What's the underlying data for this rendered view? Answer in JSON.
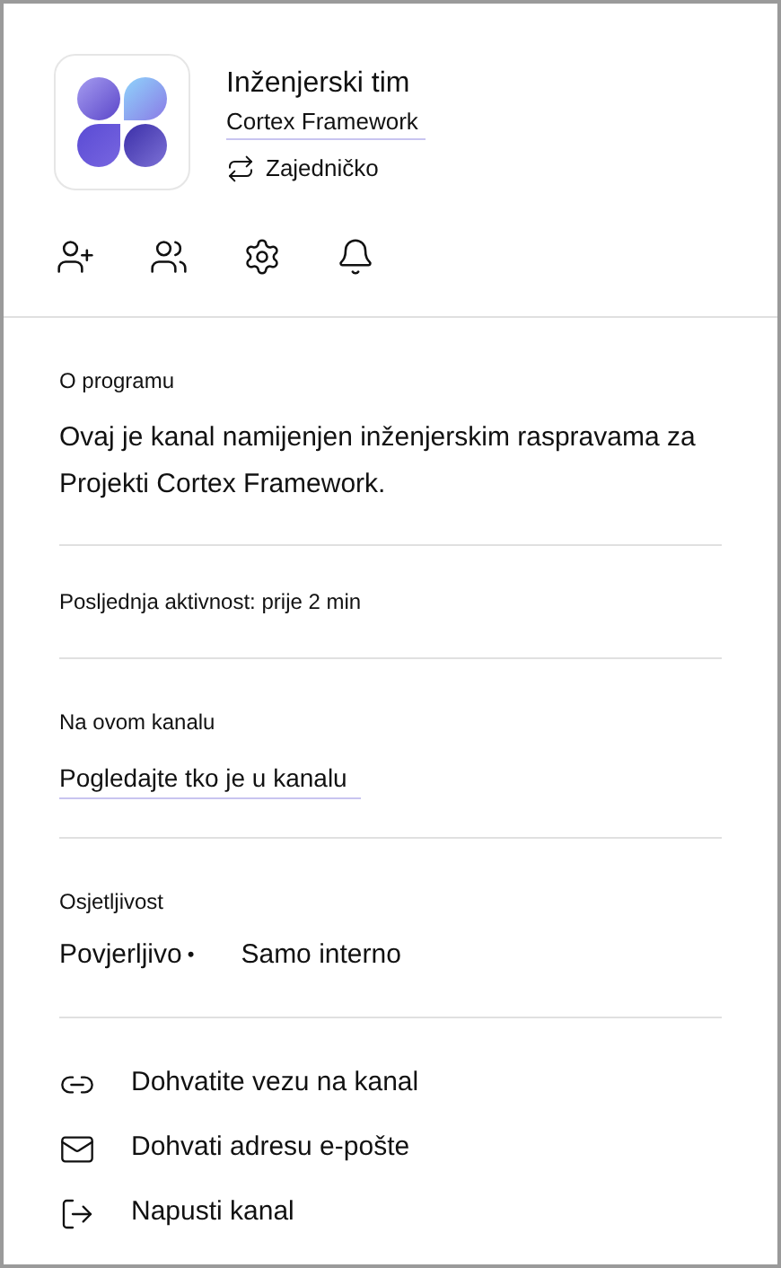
{
  "header": {
    "title": "Inženjerski tim",
    "subtitle": "Cortex Framework",
    "shared_label": "Zajedničko"
  },
  "toolbar": [
    {
      "kind": "add-member"
    },
    {
      "kind": "add-team"
    },
    {
      "kind": "settings"
    },
    {
      "kind": "notifications"
    }
  ],
  "about": {
    "heading": "O programu",
    "text": "Ovaj je kanal namijenjen inženjerskim raspravama za Projekti Cortex Framework."
  },
  "activity": "Posljednja aktivnost: prije 2 min",
  "members": {
    "heading": "Na ovom kanalu",
    "link": "Pogledajte tko je u kanalu"
  },
  "sensitivity": {
    "heading": "Osjetljivost",
    "label": "Povjerljivo",
    "separator": "•",
    "value": "Samo interno"
  },
  "actions": [
    {
      "kind": "link",
      "label": "Dohvatite vezu na kanal"
    },
    {
      "kind": "mail",
      "label": "Dohvati adresu e-pošte"
    },
    {
      "kind": "leave",
      "label": "Napusti kanal"
    }
  ]
}
